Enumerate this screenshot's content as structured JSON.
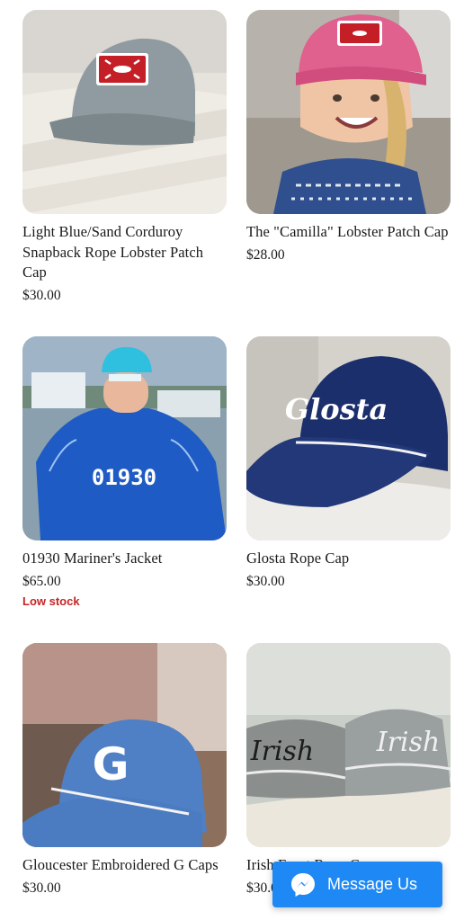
{
  "products": [
    {
      "title": "Light Blue/Sand Corduroy Snapback Rope Lobster Patch Cap",
      "price": "$30.00",
      "stock": ""
    },
    {
      "title": "The \"Camilla\" Lobster Patch Cap",
      "price": "$28.00",
      "stock": ""
    },
    {
      "title": "01930 Mariner's Jacket",
      "price": "$65.00",
      "stock": "Low stock",
      "image_text": "01930"
    },
    {
      "title": "Glosta Rope Cap",
      "price": "$30.00",
      "stock": "",
      "image_text": "Glosta"
    },
    {
      "title": "Gloucester Embroidered G Caps",
      "price": "$30.00",
      "stock": "",
      "image_text": "G"
    },
    {
      "title": "Irish Front Rope Cap",
      "price": "$30.00",
      "stock": "",
      "image_text": "Irish"
    }
  ],
  "message_button": {
    "label": "Message Us",
    "icon": "messenger-icon"
  },
  "colors": {
    "accent": "#1e89f5",
    "low_stock": "#c72323"
  }
}
